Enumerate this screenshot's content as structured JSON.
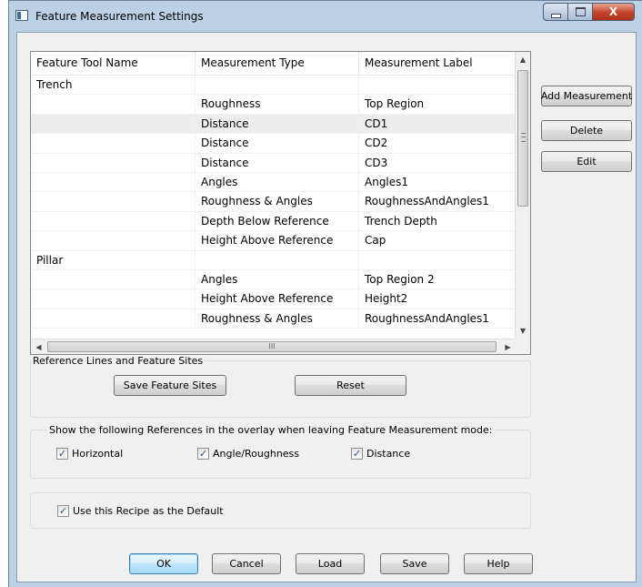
{
  "window": {
    "title": "Feature Measurement Settings",
    "close_glyph": "X"
  },
  "list": {
    "columns": [
      "Feature Tool Name",
      "Measurement Type",
      "Measurement Label"
    ],
    "rows": [
      {
        "tool": "Trench",
        "type": "",
        "label": ""
      },
      {
        "tool": "",
        "type": "Roughness",
        "label": "Top Region"
      },
      {
        "tool": "",
        "type": "Distance",
        "label": "CD1"
      },
      {
        "tool": "",
        "type": "Distance",
        "label": "CD2"
      },
      {
        "tool": "",
        "type": "Distance",
        "label": "CD3"
      },
      {
        "tool": "",
        "type": "Angles",
        "label": "Angles1"
      },
      {
        "tool": "",
        "type": "Roughness & Angles",
        "label": "RoughnessAndAngles1"
      },
      {
        "tool": "",
        "type": "Depth Below Reference",
        "label": "Trench Depth"
      },
      {
        "tool": "",
        "type": "Height Above Reference",
        "label": "Cap"
      },
      {
        "tool": "Pillar",
        "type": "",
        "label": ""
      },
      {
        "tool": "",
        "type": "Angles",
        "label": "Top Region 2"
      },
      {
        "tool": "",
        "type": "Height Above Reference",
        "label": "Height2"
      },
      {
        "tool": "",
        "type": "Roughness & Angles",
        "label": "RoughnessAndAngles1"
      }
    ],
    "selected_row": 2,
    "scroll_up_glyph": "▲",
    "scroll_down_glyph": "▼",
    "scroll_left_glyph": "◀",
    "scroll_right_glyph": "▶",
    "hthumb_grip": "III"
  },
  "side_buttons": {
    "add": "Add Measurement",
    "delete": "Delete",
    "edit": "Edit"
  },
  "reference_group": {
    "label": "Reference Lines and Feature Sites",
    "save_sites": "Save Feature Sites",
    "reset": "Reset"
  },
  "overlay_group": {
    "label": "Show the following References in the overlay when leaving Feature Measurement mode:",
    "horizontal": "Horizontal",
    "angle_roughness": "Angle/Roughness",
    "distance": "Distance",
    "horizontal_checked": true,
    "angle_roughness_checked": true,
    "distance_checked": true
  },
  "default_group": {
    "use_default": "Use this Recipe as the Default",
    "use_default_checked": true
  },
  "check_glyph": "✓",
  "footer": {
    "ok": "OK",
    "cancel": "Cancel",
    "load": "Load",
    "save": "Save",
    "help": "Help"
  }
}
